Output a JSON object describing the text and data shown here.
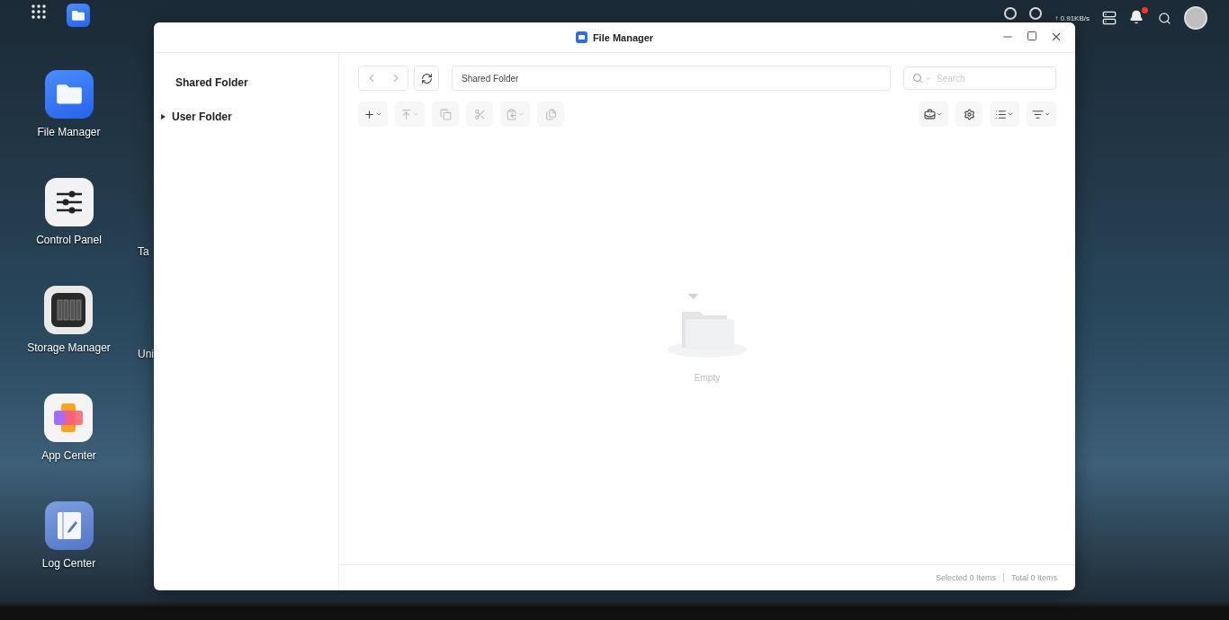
{
  "desktop": {
    "apps": [
      {
        "kind": "file-manager",
        "label": "File Manager"
      },
      {
        "kind": "control-panel",
        "label": "Control Panel"
      },
      {
        "kind": "storage-manager",
        "label": "Storage Manager"
      },
      {
        "kind": "app-center",
        "label": "App Center"
      },
      {
        "kind": "log-center",
        "label": "Log Center"
      }
    ],
    "hidden_column_labels": [
      "Ta",
      "Uni"
    ]
  },
  "top_bar": {
    "upload_speed": "↑ 0.91KB/s",
    "notification_unread": true
  },
  "window": {
    "title": "File Manager",
    "sidebar": {
      "items": [
        {
          "label": "Shared Folder",
          "kind": "leaf"
        },
        {
          "label": "User Folder",
          "kind": "expandable"
        }
      ]
    },
    "path": "Shared Folder",
    "search": {
      "placeholder": "Search"
    },
    "toolbar_left": [
      {
        "kind": "new",
        "dropdown": true,
        "disabled": false
      },
      {
        "kind": "upload",
        "dropdown": true,
        "disabled": true
      },
      {
        "kind": "copy",
        "dropdown": false,
        "disabled": true
      },
      {
        "kind": "cut",
        "dropdown": false,
        "disabled": true
      },
      {
        "kind": "paste",
        "dropdown": true,
        "disabled": true
      },
      {
        "kind": "duplicate",
        "dropdown": false,
        "disabled": true
      }
    ],
    "toolbar_right": [
      {
        "kind": "tools",
        "dropdown": true,
        "disabled": false
      },
      {
        "kind": "settings",
        "dropdown": false,
        "disabled": false
      },
      {
        "kind": "view",
        "dropdown": true,
        "disabled": false
      },
      {
        "kind": "sort",
        "dropdown": true,
        "disabled": false
      }
    ],
    "empty_text": "Empty",
    "status_bar": {
      "selected": "Selected 0 Items",
      "total": "Total 0 Items"
    }
  }
}
